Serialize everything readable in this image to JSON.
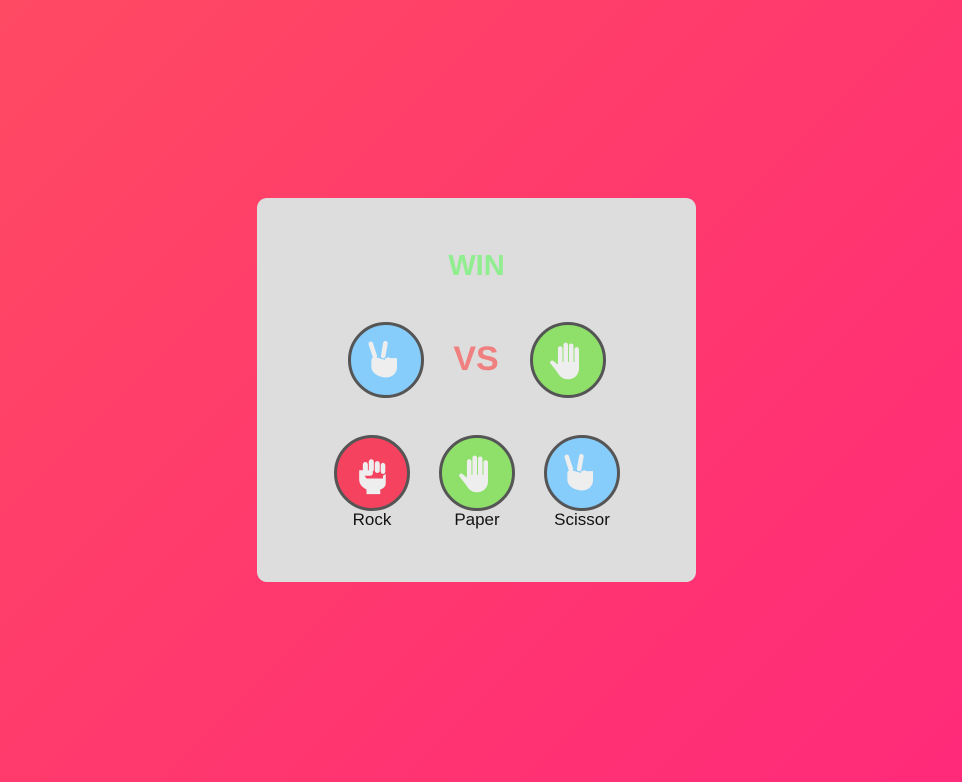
{
  "game": {
    "result": "WIN",
    "vs_label": "VS",
    "player_hand": "scissor",
    "computer_hand": "paper"
  },
  "choices": [
    {
      "label": "Rock",
      "icon": "fist-icon"
    },
    {
      "label": "Paper",
      "icon": "open-hand-icon"
    },
    {
      "label": "Scissor",
      "icon": "peace-hand-icon"
    }
  ],
  "colors": {
    "win": "#90ee90",
    "vs": "#f08080",
    "rock": "#f4425f",
    "paper": "#8ee06a",
    "scissor": "#87cdfb",
    "hand": "#eeeeee",
    "border": "#555555",
    "card": "#dddddd"
  }
}
